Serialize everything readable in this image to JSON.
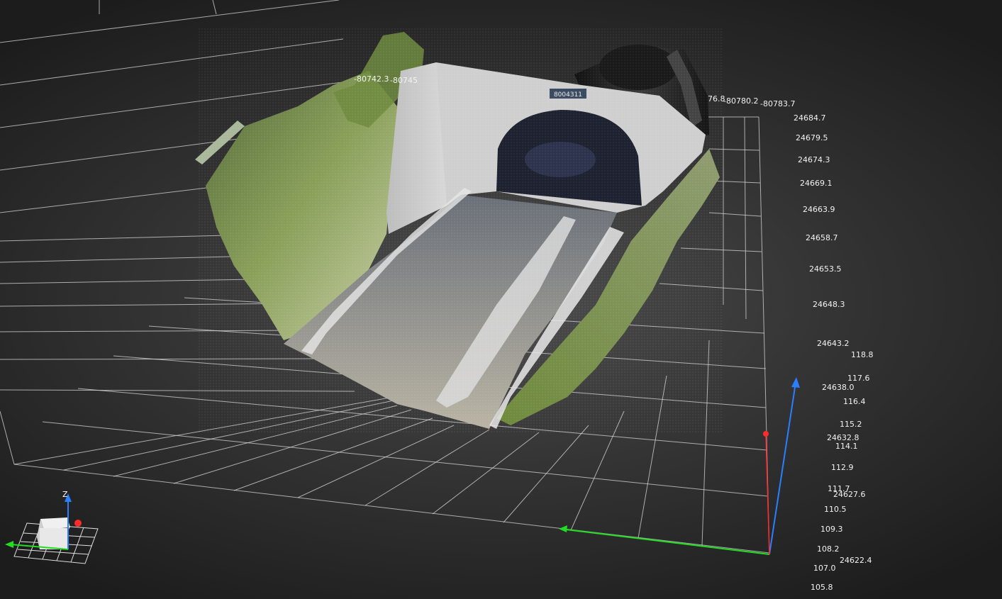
{
  "viewer": {
    "x_axis_ticks": [
      "-80742.3",
      "-80745",
      "76.8",
      "-80780.2",
      "-80783.7"
    ],
    "y_axis_ticks": [
      "24684.7",
      "24679.5",
      "24674.3",
      "24669.1",
      "24663.9",
      "24658.7",
      "24653.5",
      "24648.3",
      "24643.2",
      "24638.0",
      "24632.8",
      "24627.6",
      "24622.4"
    ],
    "z_axis_ticks": [
      "118.8",
      "117.6",
      "116.4",
      "115.2",
      "114.1",
      "112.9",
      "111.7",
      "110.5",
      "109.3",
      "108.2",
      "107.0",
      "105.8"
    ],
    "axis_colors": {
      "x": "#ff2a2a",
      "y": "#22dd22",
      "z": "#2a7fff"
    },
    "gizmo": {
      "z_label": "Z"
    },
    "tunnel_sign": "8004311"
  }
}
